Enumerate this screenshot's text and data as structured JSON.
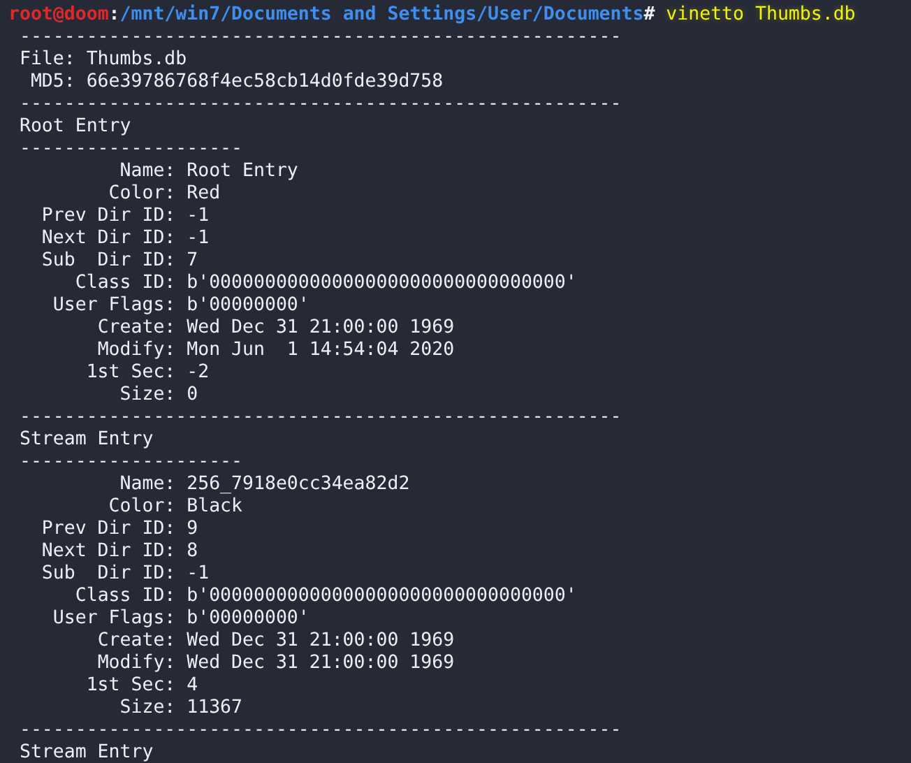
{
  "terminal": {
    "prompt": {
      "user_host": "root@doom",
      "separator": ":",
      "path": "/mnt/win7/Documents and Settings/User/Documents",
      "symbol": "#",
      "command": "vinetto Thumbs.db"
    },
    "lines": [
      {
        "kind": "rule",
        "text": "------------------------------------------------------"
      },
      {
        "kind": "file_field",
        "label": "File:",
        "value": "Thumbs.db"
      },
      {
        "kind": "file_field",
        "label": "MD5:",
        "value": "66e39786768f4ec58cb14d0fde39d758"
      },
      {
        "kind": "rule",
        "text": "------------------------------------------------------"
      },
      {
        "kind": "heading",
        "text": "Root Entry"
      },
      {
        "kind": "rule",
        "text": "--------------------"
      },
      {
        "kind": "field",
        "label": "Name:",
        "value": "Root Entry"
      },
      {
        "kind": "field",
        "label": "Color:",
        "value": "Red"
      },
      {
        "kind": "field",
        "label": "Prev Dir ID:",
        "value": "-1"
      },
      {
        "kind": "field",
        "label": "Next Dir ID:",
        "value": "-1"
      },
      {
        "kind": "field",
        "label": "Sub  Dir ID:",
        "value": "7"
      },
      {
        "kind": "field",
        "label": "Class ID:",
        "value": "b'00000000000000000000000000000000'"
      },
      {
        "kind": "field",
        "label": "User Flags:",
        "value": "b'00000000'"
      },
      {
        "kind": "field",
        "label": "Create:",
        "value": "Wed Dec 31 21:00:00 1969"
      },
      {
        "kind": "field",
        "label": "Modify:",
        "value": "Mon Jun  1 14:54:04 2020"
      },
      {
        "kind": "field",
        "label": "1st Sec:",
        "value": "-2"
      },
      {
        "kind": "field",
        "label": "Size:",
        "value": "0"
      },
      {
        "kind": "rule",
        "text": "------------------------------------------------------"
      },
      {
        "kind": "heading",
        "text": "Stream Entry"
      },
      {
        "kind": "rule",
        "text": "--------------------"
      },
      {
        "kind": "field",
        "label": "Name:",
        "value": "256_7918e0cc34ea82d2"
      },
      {
        "kind": "field",
        "label": "Color:",
        "value": "Black"
      },
      {
        "kind": "field",
        "label": "Prev Dir ID:",
        "value": "9"
      },
      {
        "kind": "field",
        "label": "Next Dir ID:",
        "value": "8"
      },
      {
        "kind": "field",
        "label": "Sub  Dir ID:",
        "value": "-1"
      },
      {
        "kind": "field",
        "label": "Class ID:",
        "value": "b'00000000000000000000000000000000'"
      },
      {
        "kind": "field",
        "label": "User Flags:",
        "value": "b'00000000'"
      },
      {
        "kind": "field",
        "label": "Create:",
        "value": "Wed Dec 31 21:00:00 1969"
      },
      {
        "kind": "field",
        "label": "Modify:",
        "value": "Wed Dec 31 21:00:00 1969"
      },
      {
        "kind": "field",
        "label": "1st Sec:",
        "value": "4"
      },
      {
        "kind": "field",
        "label": "Size:",
        "value": "11367"
      },
      {
        "kind": "rule",
        "text": "------------------------------------------------------"
      },
      {
        "kind": "heading",
        "text": "Stream Entry"
      }
    ]
  }
}
